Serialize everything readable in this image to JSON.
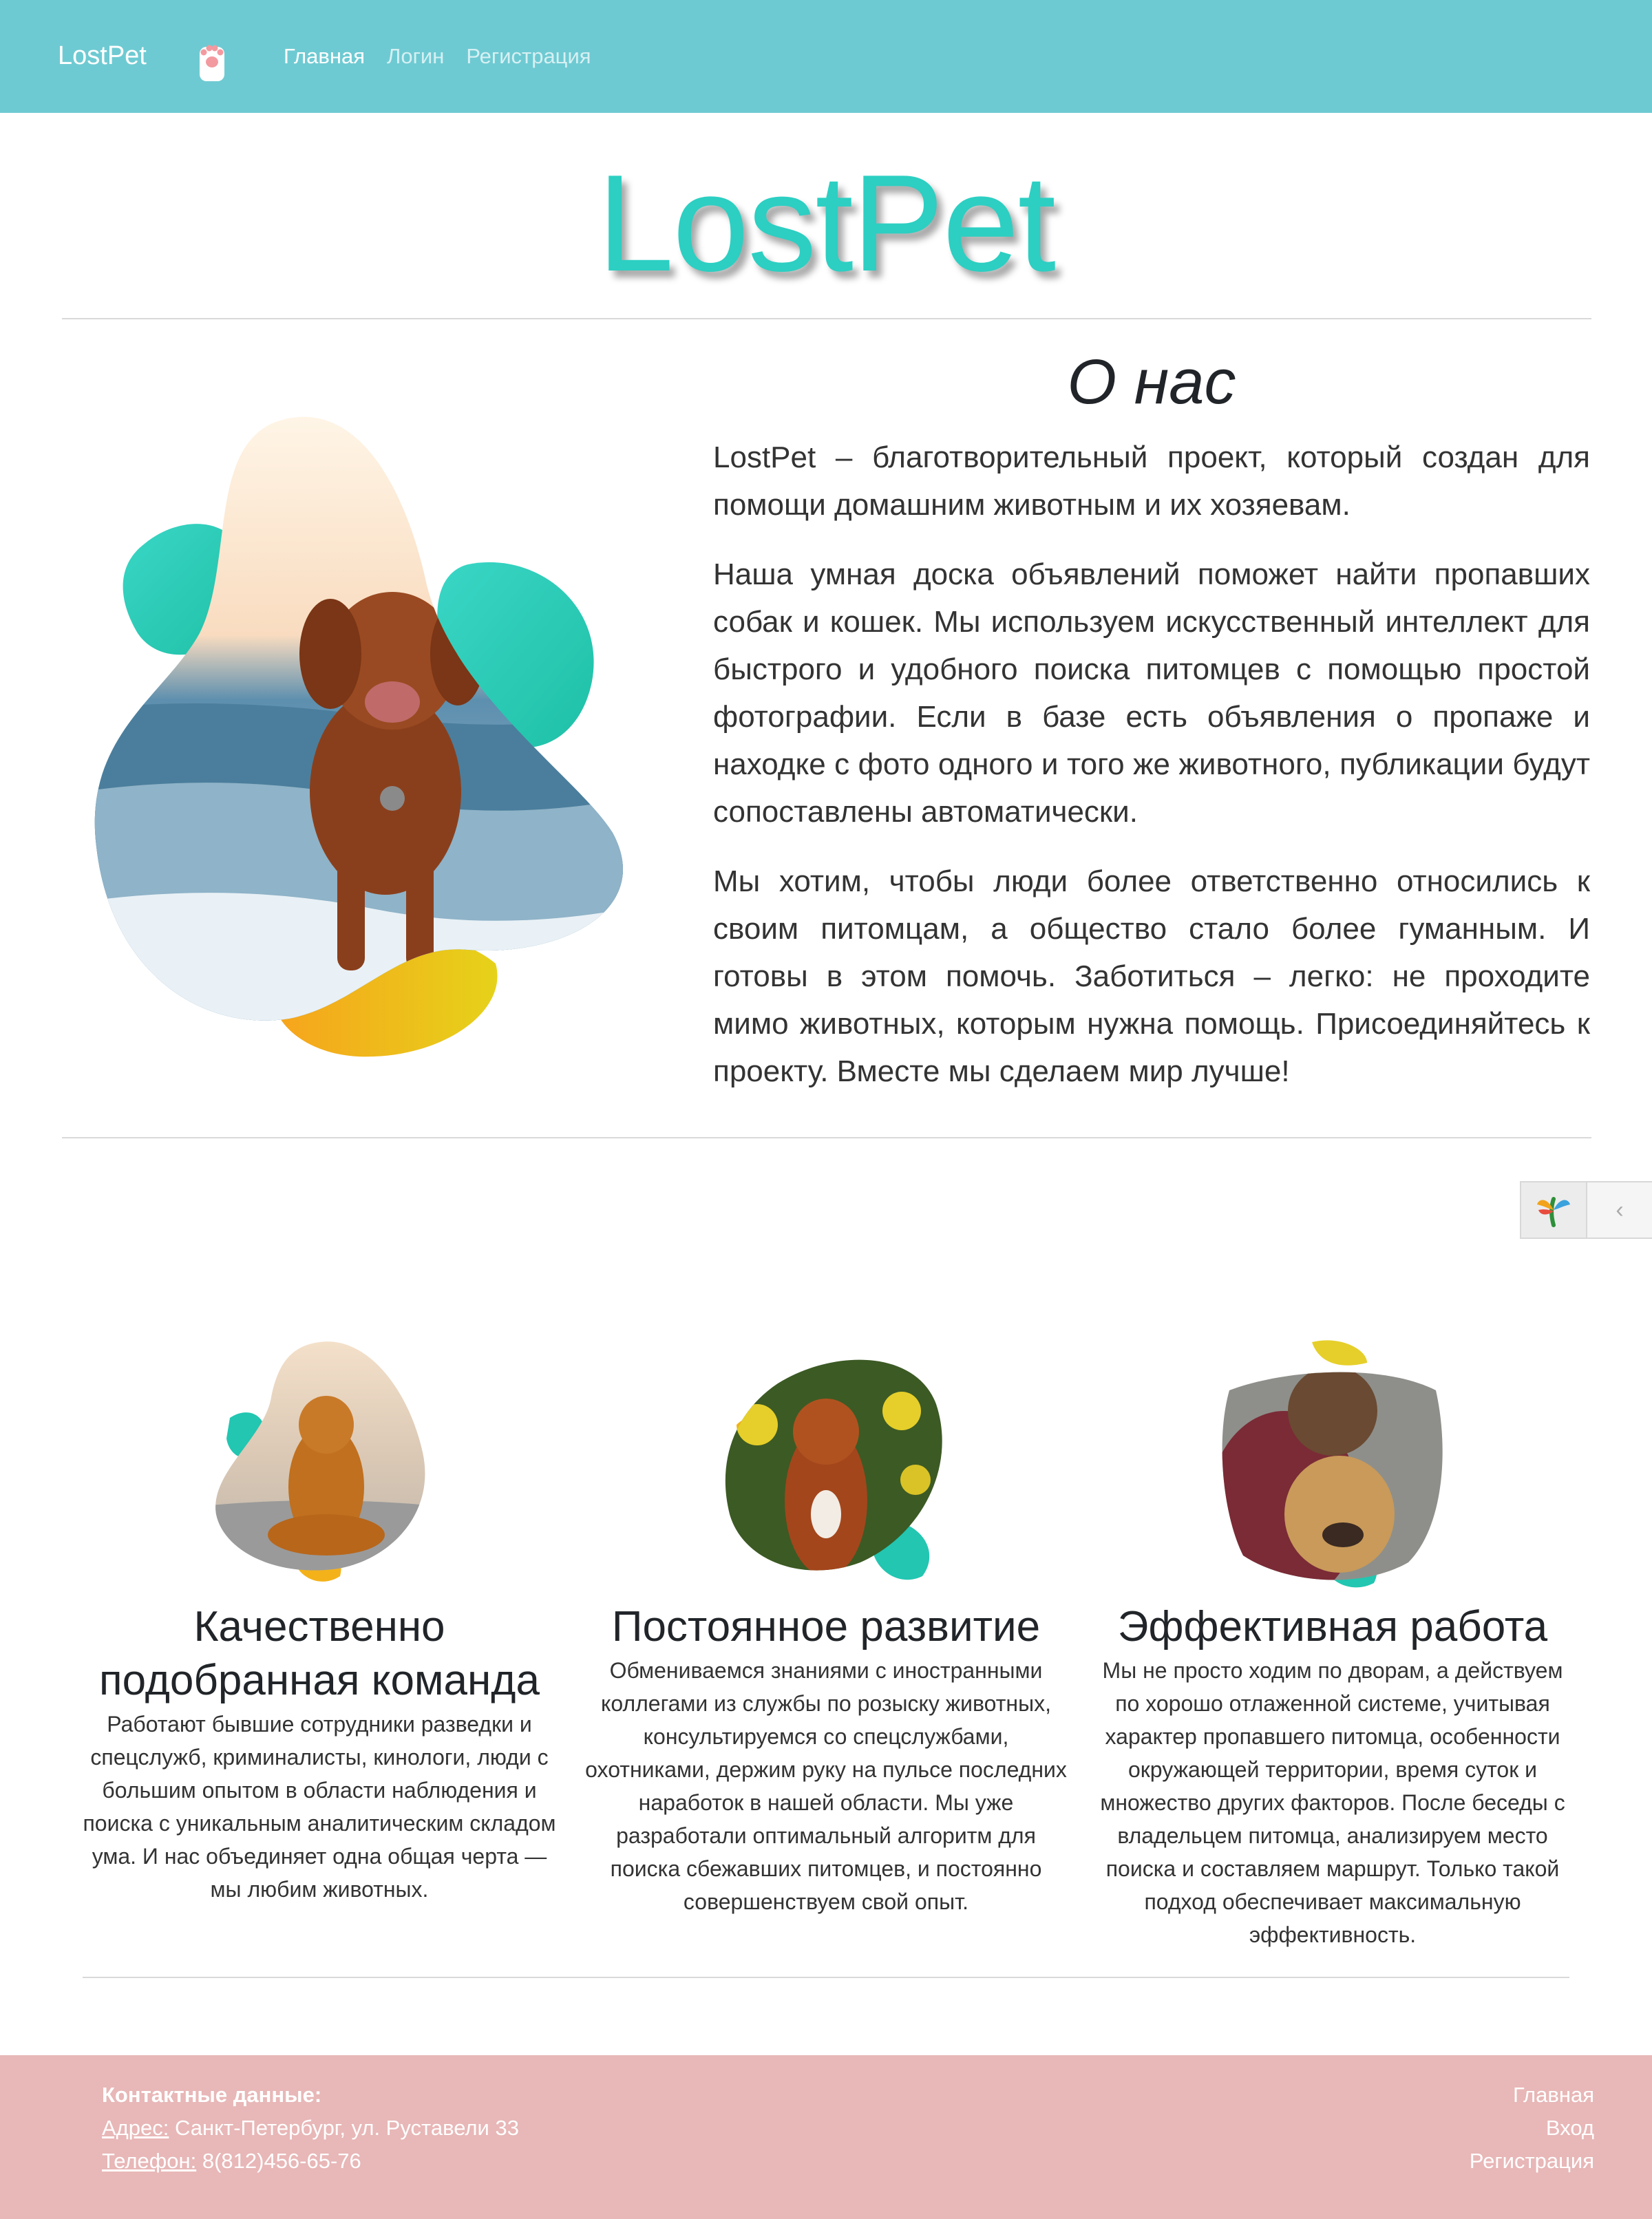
{
  "nav": {
    "brand": "LostPet",
    "links": [
      {
        "label": "Главная",
        "active": true
      },
      {
        "label": "Логин",
        "active": false
      },
      {
        "label": "Регистрация",
        "active": false
      }
    ]
  },
  "hero": {
    "title": "LostPet"
  },
  "about": {
    "title": "О нас",
    "paragraphs": [
      "LostPet – благотворительный проект, который создан для помощи домашним животным и их хозяевам.",
      "Наша умная доска объявлений поможет найти пропавших собак и кошек. Мы используем искусственный интеллект для быстрого и удобного поиска питомцев с помощью простой фотографии. Если в базе есть объявления о пропаже и находке с фото одного и того же животного, публикации будут сопоставлены автоматически.",
      "Мы хотим, чтобы люди более ответственно относились к своим питомцам, а общество стало более гуманным. И готовы в этом помочь. Заботиться – легко: не проходите мимо животных, которым нужна помощь. Присоединяйтесь к проекту. Вместе мы сделаем мир лучше!"
    ]
  },
  "widget": {
    "arrow": "‹"
  },
  "features": [
    {
      "title": "Качественно подобранная команда",
      "text": "Работают бывшие сотрудники разведки и спецслужб, криминалисты, кинологи, люди с большим опытом в области наблюдения и поиска с уникальным аналитическим складом ума. И нас объединяет одна общая черта — мы любим животных."
    },
    {
      "title": "Постоянное развитие",
      "text": "Обмениваемся знаниями с иностранными коллегами из службы по розыску животных, консультируемся со спецслужбами, охотниками, держим руку на пульсе последних наработок в нашей области. Мы уже разработали оптимальный алгоритм для поиска сбежавших питомцев, и постоянно совершенствуем свой опыт."
    },
    {
      "title": "Эффективная работа",
      "text": "Мы не просто ходим по дворам, а действуем по хорошо отлаженной системе, учитывая характер пропавшего питомца, особенности окружающей территории, время суток и множество других факторов. После беседы с владельцем питомца, анализируем место поиска и составляем маршрут. Только такой подход обеспечивает максимальную эффективность."
    }
  ],
  "footer": {
    "heading": "Контактные данные:",
    "address_label": "Адрес:",
    "address": "Санкт-Петербург, ул. Руставели 33",
    "phone_label": "Телефон:",
    "phone": "8(812)456-65-76",
    "links": [
      "Главная",
      "Вход",
      "Регистрация"
    ]
  },
  "colors": {
    "navbar": "#6ecad2",
    "accent": "#2ccfc2",
    "footer": "#e8b7b7"
  }
}
